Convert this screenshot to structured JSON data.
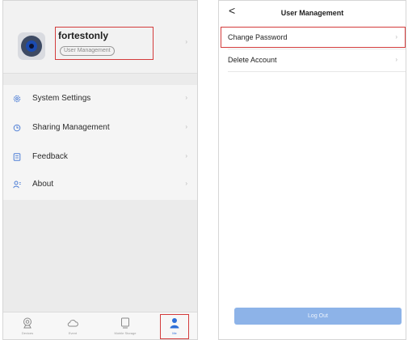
{
  "left_panel": {
    "profile": {
      "username": "fortestonly",
      "pill_label": "User Management",
      "chevron": "›",
      "avatar_icon": "camera-lens-icon"
    },
    "menu": [
      {
        "label": "System Settings",
        "icon": "gear-icon",
        "chevron": "›"
      },
      {
        "label": "Sharing Management",
        "icon": "share-icon",
        "chevron": "›"
      },
      {
        "label": "Feedback",
        "icon": "feedback-icon",
        "chevron": "›"
      },
      {
        "label": "About",
        "icon": "person-icon",
        "chevron": "›"
      }
    ],
    "tabs": [
      {
        "label": "Devices",
        "icon": "camera-icon"
      },
      {
        "label": "Event",
        "icon": "cloud-icon"
      },
      {
        "label": "Mobile Storage",
        "icon": "storage-icon"
      },
      {
        "label": "Me",
        "icon": "user-icon",
        "active": true
      }
    ]
  },
  "right_panel": {
    "title": "User Management",
    "back_glyph": "<",
    "rows": [
      {
        "label": "Change Password",
        "chevron": "›"
      },
      {
        "label": "Delete Account",
        "chevron": "›"
      }
    ],
    "logout_label": "Log Out"
  },
  "colors": {
    "accent_blue": "#2e6fd8",
    "highlight_red": "#d33c3c",
    "logout_button": "#8db3e8",
    "icon_blue": "#4f7fd6"
  }
}
